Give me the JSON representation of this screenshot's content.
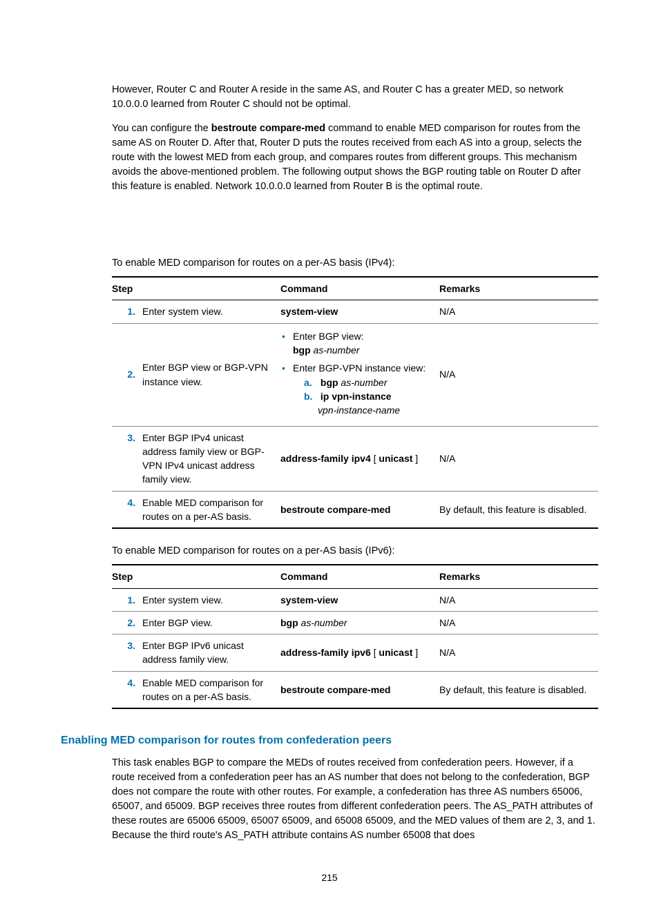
{
  "p1": "However, Router C and Router A reside in the same AS, and Router C has a greater MED, so network 10.0.0.0 learned from Router C should not be optimal.",
  "p2a": "You can configure the ",
  "p2b": "bestroute compare-med",
  "p2c": " command to enable MED comparison for routes from the same AS on Router D. After that, Router D puts the routes received from each AS into a group, selects the route with the lowest MED from each group, and compares routes from different groups. This mechanism avoids the above-mentioned problem. The following output shows the BGP routing table on Router D after this feature is enabled. Network 10.0.0.0 learned from Router B is the optimal route.",
  "caption_ipv4": "To enable MED comparison for routes on a per-AS basis (IPv4):",
  "caption_ipv6": "To enable MED comparison for routes on a per-AS basis (IPv6):",
  "headers": {
    "step": "Step",
    "command": "Command",
    "remarks": "Remarks"
  },
  "na": "N/A",
  "default_disabled": "By default, this feature is disabled.",
  "t1": {
    "r1": {
      "num": "1.",
      "step": "Enter system view.",
      "cmd": "system-view"
    },
    "r2": {
      "num": "2.",
      "step": "Enter BGP view or BGP-VPN instance view.",
      "li1": "Enter BGP view:",
      "li1b_bold": "bgp",
      "li1b_it": " as-number",
      "li2": "Enter BGP-VPN instance view:",
      "suba": "a.",
      "suba_bold": "bgp",
      "suba_it": " as-number",
      "subb": "b.",
      "subb_bold": "ip vpn-instance",
      "subb_it": "vpn-instance-name"
    },
    "r3": {
      "num": "3.",
      "step": "Enter BGP IPv4 unicast address family view or BGP-VPN IPv4 unicast address family view.",
      "cmd_bold": "address-family ipv4",
      "cmd_plain": " [ ",
      "cmd_bold2": "unicast",
      "cmd_plain2": " ]"
    },
    "r4": {
      "num": "4.",
      "step": "Enable MED comparison for routes on a per-AS basis.",
      "cmd": "bestroute compare-med"
    }
  },
  "t2": {
    "r1": {
      "num": "1.",
      "step": "Enter system view.",
      "cmd": "system-view"
    },
    "r2": {
      "num": "2.",
      "step": "Enter BGP view.",
      "cmd_bold": "bgp",
      "cmd_it": " as-number"
    },
    "r3": {
      "num": "3.",
      "step": "Enter BGP IPv6 unicast address family view.",
      "cmd_bold": "address-family ipv6",
      "cmd_plain": " [ ",
      "cmd_bold2": "unicast",
      "cmd_plain2": " ]"
    },
    "r4": {
      "num": "4.",
      "step": "Enable MED comparison for routes on a per-AS basis.",
      "cmd": "bestroute compare-med"
    }
  },
  "section_heading": "Enabling MED comparison for routes from confederation peers",
  "p3": "This task enables BGP to compare the MEDs of routes received from confederation peers. However, if a route received from a confederation peer has an AS number that does not belong to the confederation, BGP does not compare the route with other routes. For example, a confederation has three AS numbers 65006, 65007, and 65009. BGP receives three routes from different confederation peers. The AS_PATH attributes of these routes are 65006 65009, 65007 65009, and 65008 65009, and the MED values of them are 2, 3, and 1. Because the third route's AS_PATH attribute contains AS number 65008 that does",
  "page_number": "215"
}
